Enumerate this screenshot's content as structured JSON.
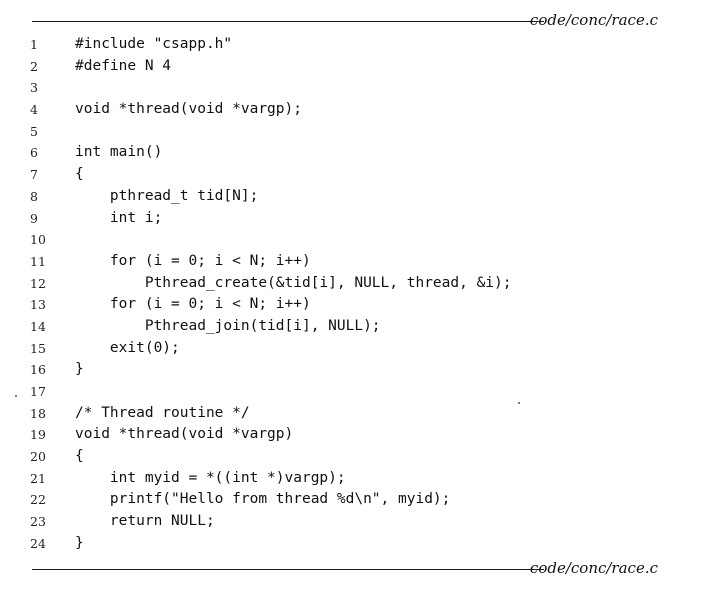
{
  "file_caption": "code/conc/race.c",
  "lines": [
    {
      "no": "1",
      "code": "#include \"csapp.h\""
    },
    {
      "no": "2",
      "code": "#define N 4"
    },
    {
      "no": "3",
      "code": ""
    },
    {
      "no": "4",
      "code": "void *thread(void *vargp);"
    },
    {
      "no": "5",
      "code": ""
    },
    {
      "no": "6",
      "code": "int main()"
    },
    {
      "no": "7",
      "code": "{"
    },
    {
      "no": "8",
      "code": "    pthread_t tid[N];"
    },
    {
      "no": "9",
      "code": "    int i;"
    },
    {
      "no": "10",
      "code": ""
    },
    {
      "no": "11",
      "code": "    for (i = 0; i < N; i++)"
    },
    {
      "no": "12",
      "code": "        Pthread_create(&tid[i], NULL, thread, &i);"
    },
    {
      "no": "13",
      "code": "    for (i = 0; i < N; i++)"
    },
    {
      "no": "14",
      "code": "        Pthread_join(tid[i], NULL);"
    },
    {
      "no": "15",
      "code": "    exit(0);"
    },
    {
      "no": "16",
      "code": "}"
    },
    {
      "no": "17",
      "code": ""
    },
    {
      "no": "18",
      "code": "/* Thread routine */"
    },
    {
      "no": "19",
      "code": "void *thread(void *vargp)"
    },
    {
      "no": "20",
      "code": "{"
    },
    {
      "no": "21",
      "code": "    int myid = *((int *)vargp);"
    },
    {
      "no": "22",
      "code": "    printf(\"Hello from thread %d\\n\", myid);"
    },
    {
      "no": "23",
      "code": "    return NULL;"
    },
    {
      "no": "24",
      "code": "}"
    }
  ]
}
